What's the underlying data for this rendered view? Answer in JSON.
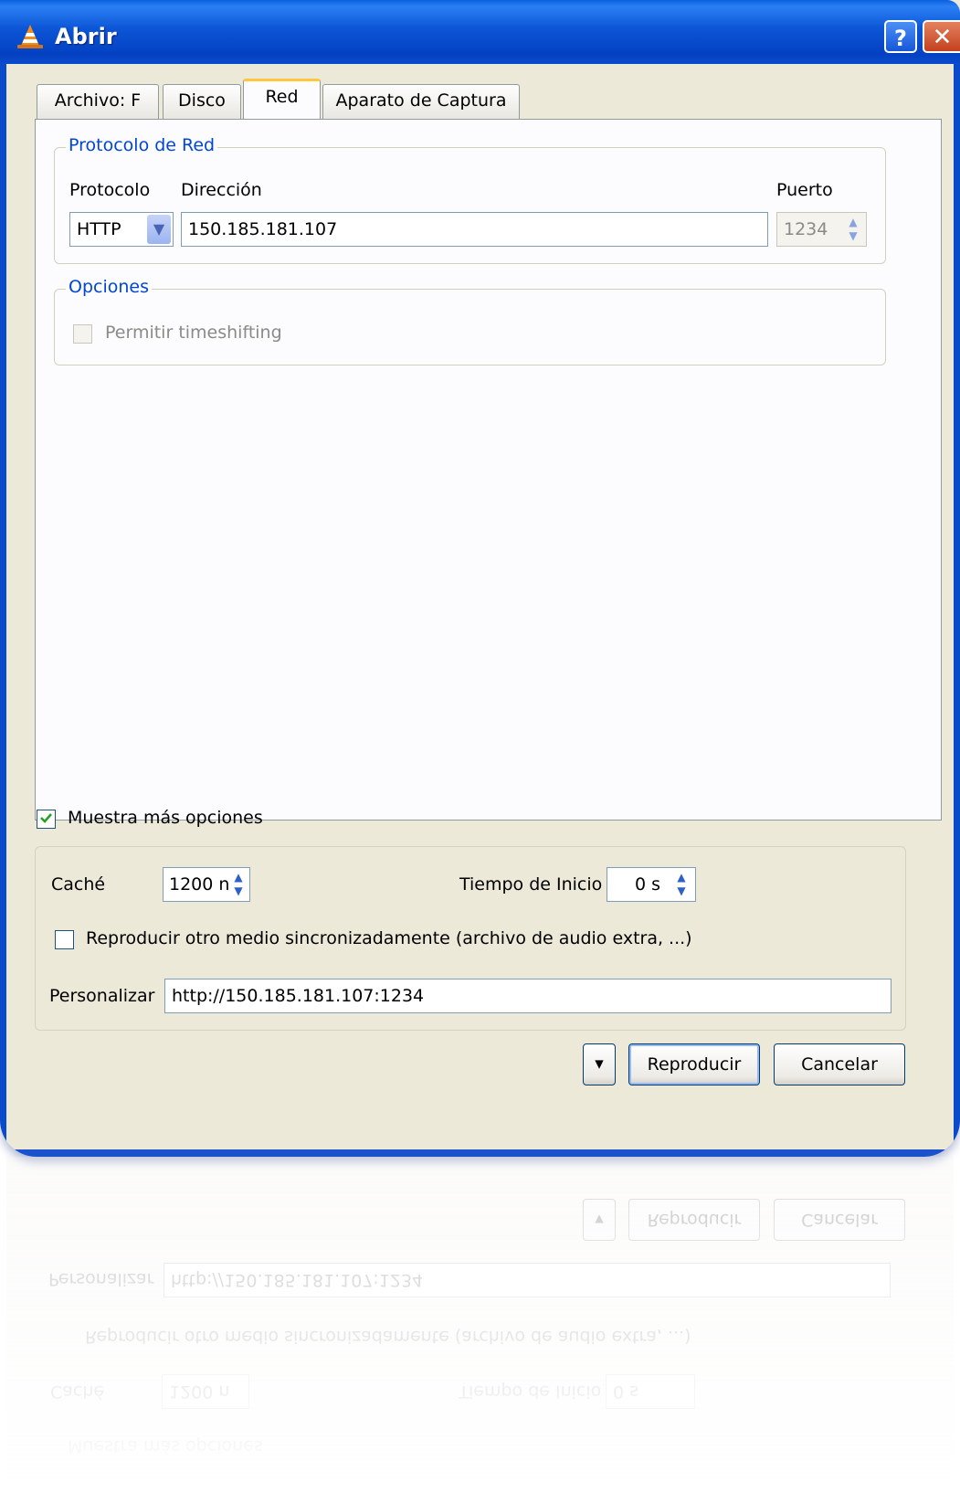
{
  "window": {
    "title": "Abrir",
    "help": "?",
    "close": "✕"
  },
  "tabs": [
    {
      "label": "Archivo: F",
      "active": false
    },
    {
      "label": "Disco",
      "active": false
    },
    {
      "label": "Red",
      "active": true
    },
    {
      "label": "Aparato de Captura",
      "active": false
    }
  ],
  "network": {
    "group_title": "Protocolo de Red",
    "protocol_label": "Protocolo",
    "address_label": "Dirección",
    "port_label": "Puerto",
    "protocol_value": "HTTP",
    "address_value": "150.185.181.107",
    "port_value": "1234"
  },
  "options": {
    "group_title": "Opciones",
    "timeshift_label": "Permitir timeshifting",
    "timeshift_checked": false
  },
  "more": {
    "show_more_label": "Muestra más opciones",
    "show_more_checked": true,
    "cache_label": "Caché",
    "cache_value": "1200 n",
    "start_label": "Tiempo de Inicio",
    "start_value": "0 s",
    "sync_label": "Reproducir otro medio sincronizadamente (archivo de audio extra, ...)",
    "sync_checked": false,
    "custom_label": "Personalizar",
    "custom_value": "http://150.185.181.107:1234"
  },
  "buttons": {
    "dropdown": "▾",
    "play": "Reproducir",
    "cancel": "Cancelar"
  }
}
